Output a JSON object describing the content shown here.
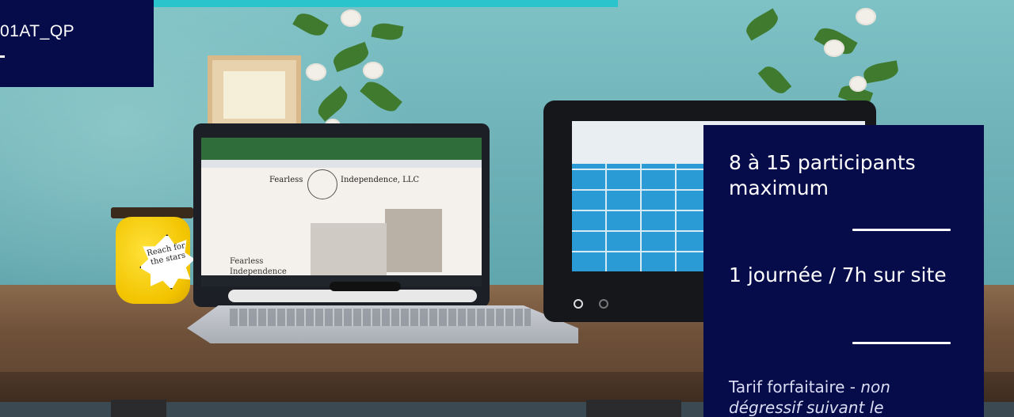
{
  "badge": {
    "code": "01AT_QP"
  },
  "info": {
    "participants": "8 à 15 participants maximum",
    "duration": "1 journée / 7h sur site",
    "price_prefix": "Tarif forfaitaire - ",
    "price_emphasis": "non dégressif suivant le"
  },
  "scene": {
    "laptop_site_name": "Fearless",
    "laptop_site_suffix": "Independence, LLC",
    "laptop_site_heading": "Fearless Independence",
    "jar_label": "Reach for the stars"
  },
  "colors": {
    "panel_navy": "#060c4a",
    "accent_cyan": "#29c4cc",
    "text_white": "#ffffff"
  }
}
